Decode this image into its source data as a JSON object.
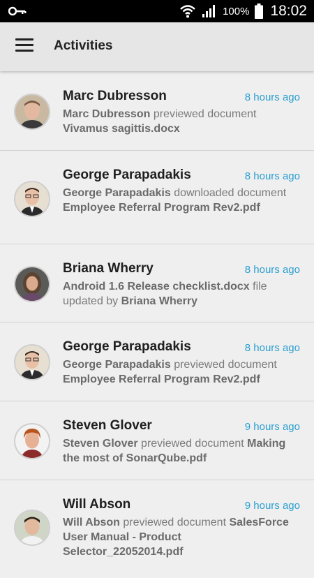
{
  "status_bar": {
    "battery": "100%",
    "time": "18:02"
  },
  "app_bar": {
    "title": "Activities"
  },
  "activities": [
    {
      "name": "Marc Dubresson",
      "time": "8 hours ago",
      "desc": [
        {
          "text": "Marc Dubresson",
          "b": true
        },
        {
          "text": " previewed document ",
          "b": false
        },
        {
          "text": "Vivamus sagittis.docx",
          "b": true
        }
      ]
    },
    {
      "name": "George Parapadakis",
      "time": "8 hours ago",
      "desc": [
        {
          "text": "George Parapadakis",
          "b": true
        },
        {
          "text": " downloaded document ",
          "b": false
        },
        {
          "text": "Employee Referral Program Rev2.pdf",
          "b": true
        }
      ]
    },
    {
      "name": "Briana Wherry",
      "time": "8 hours ago",
      "desc": [
        {
          "text": "Android 1.6 Release checklist.docx",
          "b": true
        },
        {
          "text": " file updated by ",
          "b": false
        },
        {
          "text": "Briana Wherry",
          "b": true
        }
      ]
    },
    {
      "name": "George Parapadakis",
      "time": "8 hours ago",
      "desc": [
        {
          "text": "George Parapadakis",
          "b": true
        },
        {
          "text": " previewed document ",
          "b": false
        },
        {
          "text": "Employee Referral Program Rev2.pdf",
          "b": true
        }
      ]
    },
    {
      "name": "Steven Glover",
      "time": "9 hours ago",
      "desc": [
        {
          "text": "Steven Glover",
          "b": true
        },
        {
          "text": " previewed document ",
          "b": false
        },
        {
          "text": "Making the most of SonarQube.pdf",
          "b": true
        }
      ]
    },
    {
      "name": "Will Abson",
      "time": "9 hours ago",
      "desc": [
        {
          "text": "Will Abson",
          "b": true
        },
        {
          "text": " previewed document ",
          "b": false
        },
        {
          "text": "SalesForce User Manual - Product Selector_22052014.pdf",
          "b": true
        }
      ]
    }
  ]
}
